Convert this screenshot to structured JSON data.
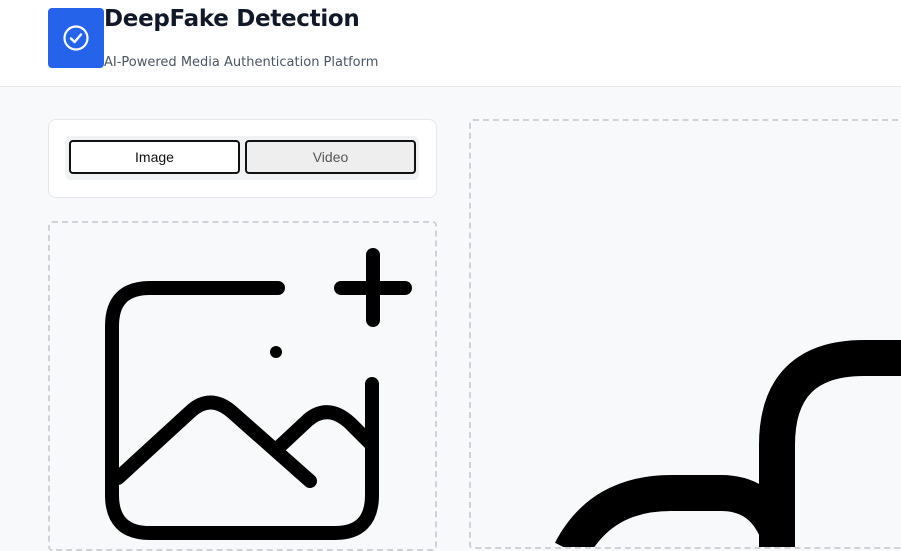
{
  "header": {
    "title": "DeepFake Detection",
    "subtitle": "AI-Powered Media Authentication Platform",
    "logo_icon": "check-circle-icon"
  },
  "media_toggle": {
    "options": [
      {
        "label": "Image",
        "selected": true
      },
      {
        "label": "Video",
        "selected": false
      }
    ]
  },
  "upload": {
    "icon": "image-add-icon"
  },
  "preview": {
    "icon": "image-placeholder-icon"
  },
  "colors": {
    "accent": "#2563eb",
    "background": "#f8f9fb",
    "border": "#cfd3d8"
  }
}
